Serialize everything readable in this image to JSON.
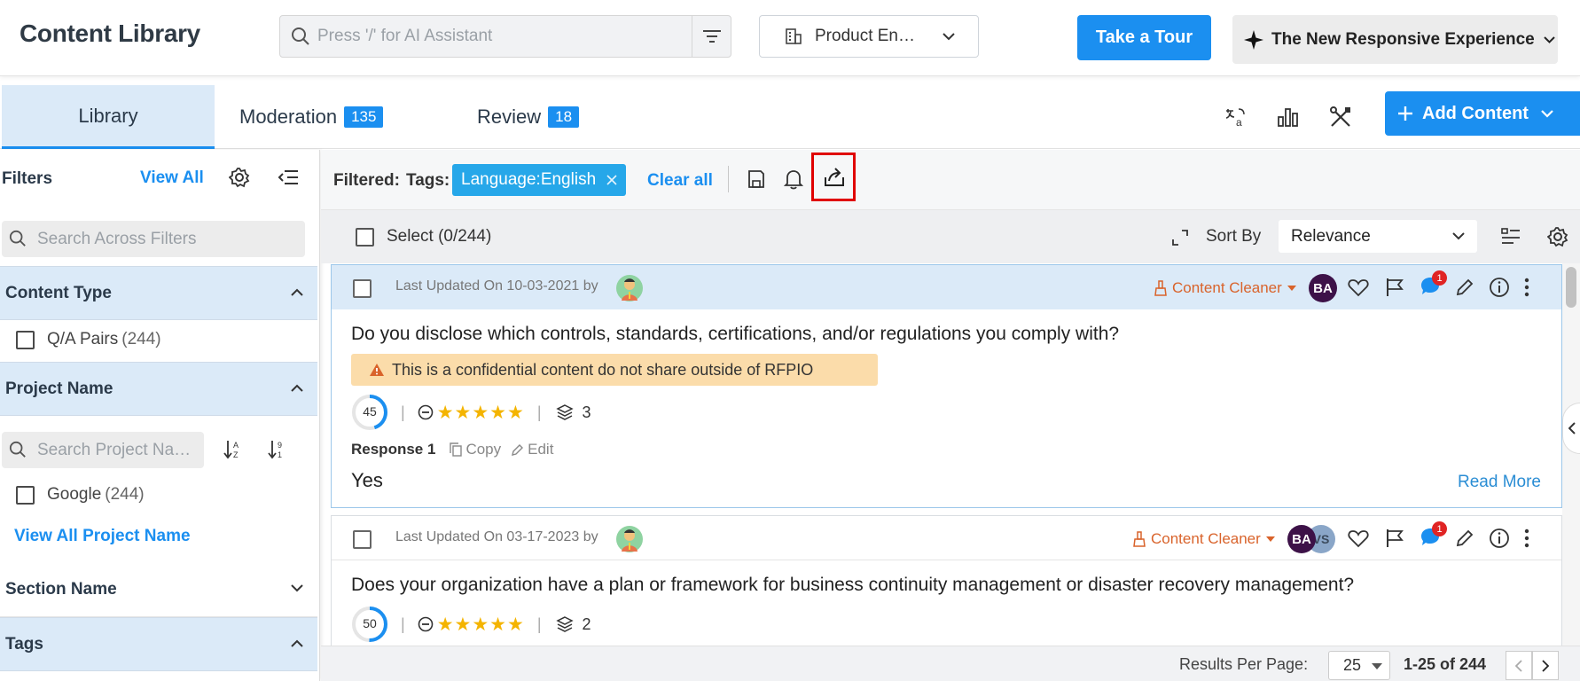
{
  "header": {
    "title": "Content Library",
    "search_placeholder": "Press '/' for AI Assistant",
    "product_selector": "Product En…",
    "tour_button": "Take a Tour",
    "experience_button": "The New Responsive Experience"
  },
  "tabs": {
    "library": "Library",
    "moderation": {
      "label": "Moderation",
      "count": "135"
    },
    "review": {
      "label": "Review",
      "count": "18"
    },
    "add_content": "Add Content"
  },
  "sidebar": {
    "filters_label": "Filters",
    "view_all": "View All",
    "search_placeholder": "Search Across Filters",
    "content_type": {
      "title": "Content Type",
      "option": "Q/A Pairs",
      "count": "(244)"
    },
    "project_name": {
      "title": "Project Name",
      "search_placeholder": "Search Project Na…",
      "option": "Google",
      "count": "(244)",
      "view_all": "View All Project Name"
    },
    "section_name": {
      "title": "Section Name"
    },
    "tags": {
      "title": "Tags"
    }
  },
  "filterbar": {
    "filtered_label": "Filtered:",
    "tags_label": "Tags:",
    "chip": "Language:English",
    "clear_all": "Clear all"
  },
  "listbar": {
    "select_label": "Select (0/244)",
    "sort_by": "Sort By",
    "sort_value": "Relevance"
  },
  "cards": [
    {
      "meta": "Last Updated On 10-03-2021 by",
      "owner": "Content Cleaner",
      "avatars": [
        "BA"
      ],
      "comments": "1",
      "question": "Do you disclose which controls, standards, certifications, and/or regulations you comply with?",
      "warning": "This is a confidential content do not share outside of RFPIO",
      "score": "45",
      "stars": "★★★★★",
      "layers": "3",
      "response_label": "Response 1",
      "copy": "Copy",
      "edit": "Edit",
      "answer": "Yes",
      "read_more": "Read More"
    },
    {
      "meta": "Last Updated On 03-17-2023 by",
      "owner": "Content Cleaner",
      "avatars": [
        "BA",
        "VS"
      ],
      "comments": "1",
      "question": "Does your organization have a plan or framework for business continuity management or disaster recovery management?",
      "score": "50",
      "stars": "★★★★★",
      "layers": "2"
    }
  ],
  "footer": {
    "per_page_label": "Results Per Page:",
    "per_page": "25",
    "range": "1-25 of 244"
  },
  "colors": {
    "accent": "#1b8ff0",
    "tab_active_bg": "#dbeaf8",
    "owner": "#d9632b",
    "highlight_box": "#e00000",
    "warning_bg": "#fbdcaa"
  }
}
